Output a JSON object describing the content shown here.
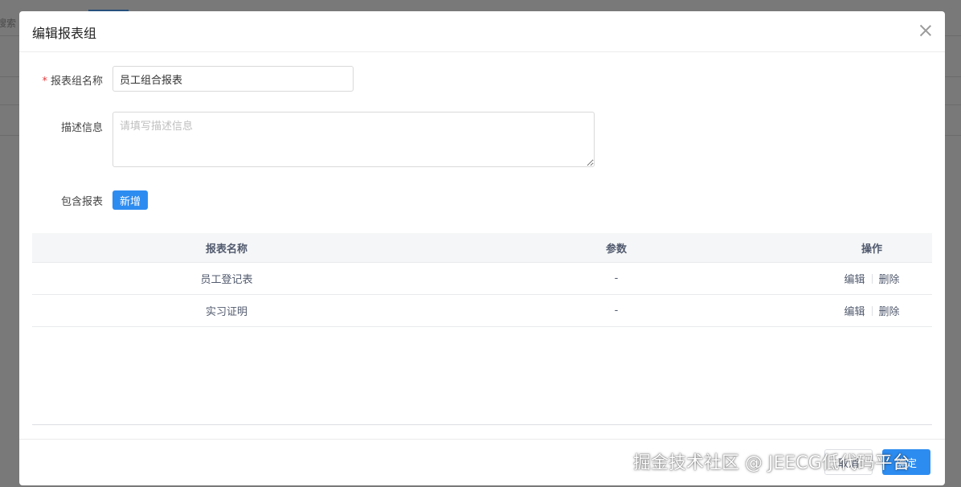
{
  "background": {
    "search_fragment": "搜索"
  },
  "dialog": {
    "title": "编辑报表组",
    "close_icon": "close-icon"
  },
  "form": {
    "name": {
      "label": "报表组名称",
      "required": true,
      "value": "员工组合报表"
    },
    "description": {
      "label": "描述信息",
      "value": "",
      "placeholder": "请填写描述信息"
    },
    "reports": {
      "label": "包含报表",
      "add_button": "新增"
    }
  },
  "table": {
    "columns": [
      "报表名称",
      "参数",
      "操作"
    ],
    "rows": [
      {
        "name": "员工登记表",
        "params": "-",
        "edit": "编辑",
        "delete": "删除"
      },
      {
        "name": "实习证明",
        "params": "-",
        "edit": "编辑",
        "delete": "删除"
      }
    ]
  },
  "footer": {
    "cancel_label": "取消",
    "confirm_label": "确定"
  },
  "watermark": "掘金技术社区 @ JEECG低代码平台",
  "colors": {
    "primary": "#2d8cf0",
    "required": "#e4393c",
    "header_bg": "#f5f6f7"
  }
}
